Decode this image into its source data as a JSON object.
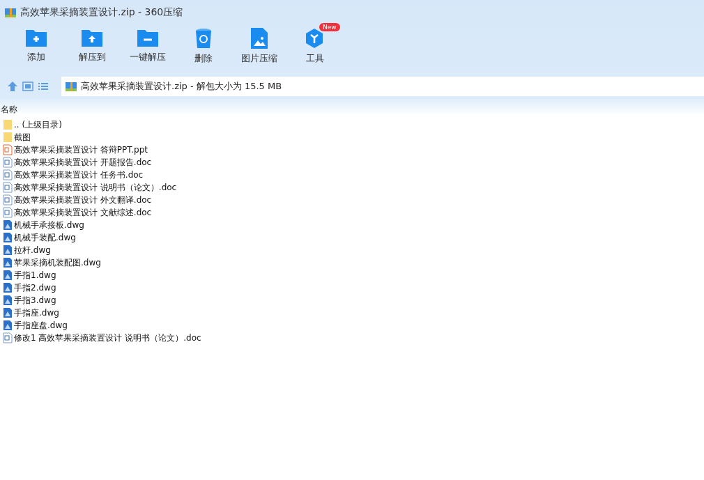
{
  "window": {
    "title": "高效苹果采摘装置设计.zip - 360压缩"
  },
  "toolbar": [
    {
      "kind": "add",
      "label": "添加"
    },
    {
      "kind": "extract-to",
      "label": "解压到"
    },
    {
      "kind": "extract",
      "label": "一键解压"
    },
    {
      "kind": "delete",
      "label": "删除"
    },
    {
      "kind": "image",
      "label": "图片压缩"
    },
    {
      "kind": "tools",
      "label": "工具",
      "badge": "New"
    }
  ],
  "address": {
    "text": "高效苹果采摘装置设计.zip - 解包大小为 15.5 MB"
  },
  "table": {
    "columns": [
      "名称"
    ],
    "rows": [
      {
        "kind": "folder",
        "name": ".. (上级目录)"
      },
      {
        "kind": "folder",
        "name": "截图"
      },
      {
        "kind": "ppt",
        "name": "高效苹果采摘装置设计 答辩PPT.ppt"
      },
      {
        "kind": "doc",
        "name": "高效苹果采摘装置设计 开题报告.doc"
      },
      {
        "kind": "doc",
        "name": "高效苹果采摘装置设计 任务书.doc"
      },
      {
        "kind": "doc",
        "name": "高效苹果采摘装置设计 说明书（论文）.doc"
      },
      {
        "kind": "doc",
        "name": "高效苹果采摘装置设计 外文翻译.doc"
      },
      {
        "kind": "doc",
        "name": "高效苹果采摘装置设计 文献综述.doc"
      },
      {
        "kind": "dwg",
        "name": "机械手承接板.dwg"
      },
      {
        "kind": "dwg",
        "name": "机械手装配.dwg"
      },
      {
        "kind": "dwg",
        "name": "拉杆.dwg"
      },
      {
        "kind": "dwg",
        "name": "苹果采摘机装配图.dwg"
      },
      {
        "kind": "dwg",
        "name": "手指1.dwg"
      },
      {
        "kind": "dwg",
        "name": "手指2.dwg"
      },
      {
        "kind": "dwg",
        "name": "手指3.dwg"
      },
      {
        "kind": "dwg",
        "name": "手指座.dwg"
      },
      {
        "kind": "dwg",
        "name": "手指座盘.dwg"
      },
      {
        "kind": "doc",
        "name": "修改1 高效苹果采摘装置设计 说明书（论文）.doc"
      }
    ]
  }
}
